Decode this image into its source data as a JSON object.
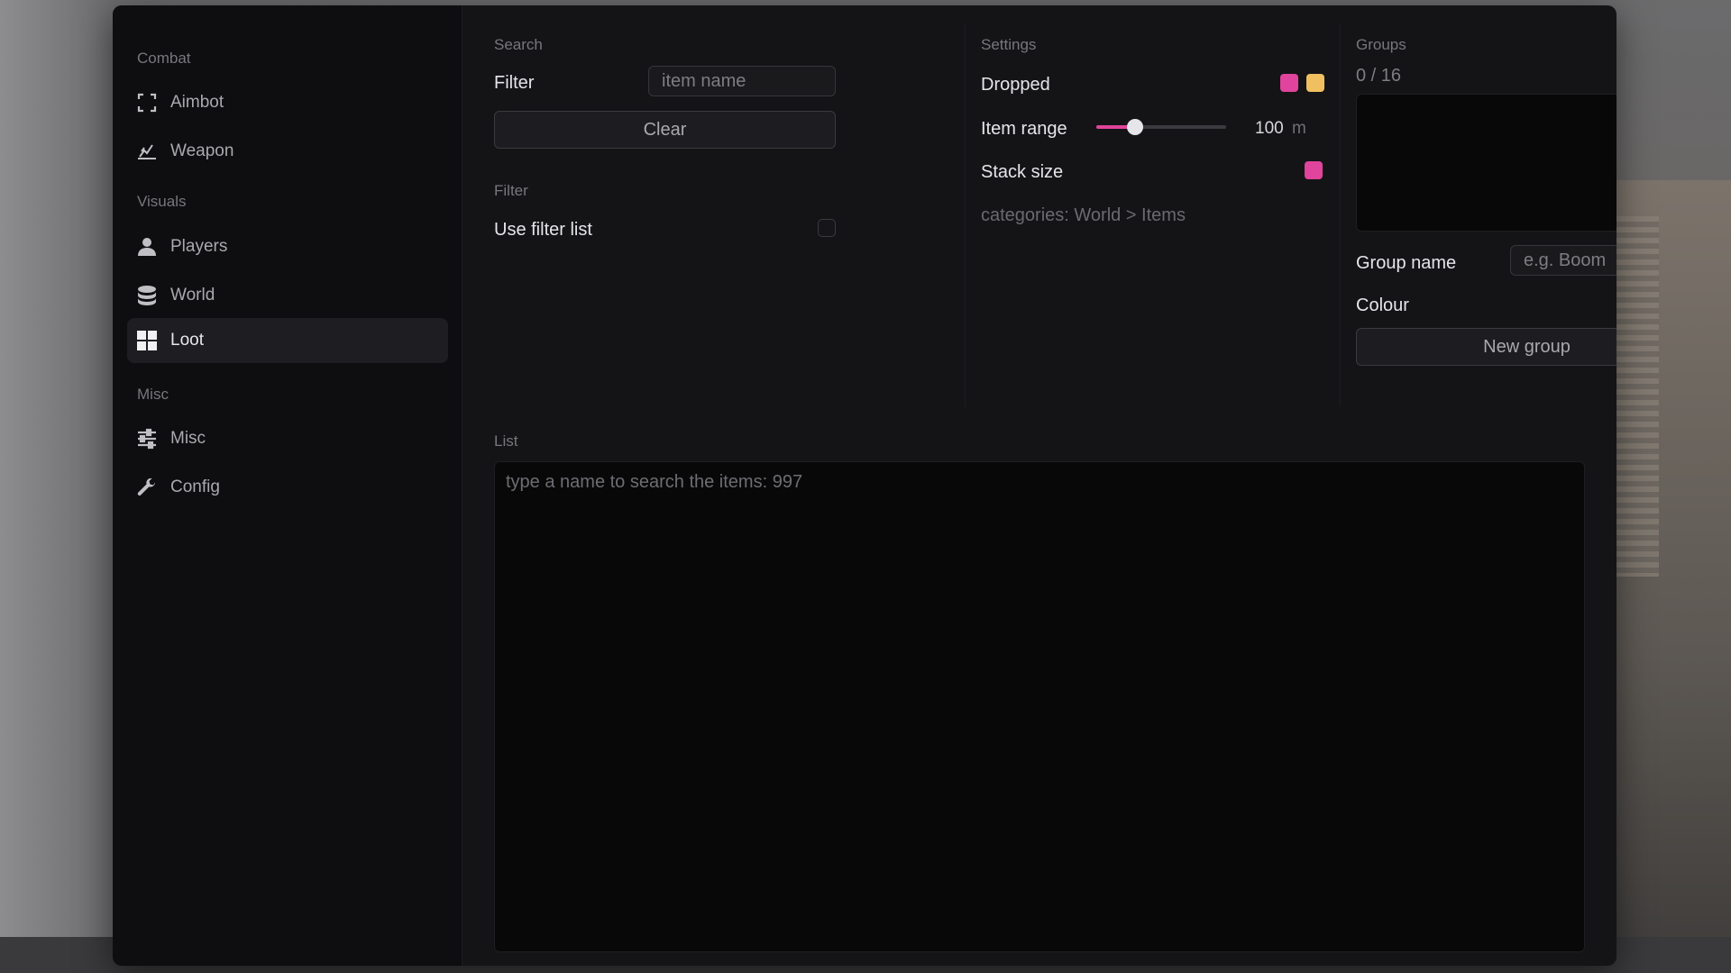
{
  "sidebar": {
    "sections": [
      {
        "title": "Combat",
        "items": [
          {
            "label": "Aimbot",
            "icon": "crosshair-bracket-icon"
          },
          {
            "label": "Weapon",
            "icon": "weapon-icon"
          }
        ]
      },
      {
        "title": "Visuals",
        "items": [
          {
            "label": "Players",
            "icon": "user-icon"
          },
          {
            "label": "World",
            "icon": "database-icon"
          },
          {
            "label": "Loot",
            "icon": "grid-icon",
            "active": true
          }
        ]
      },
      {
        "title": "Misc",
        "items": [
          {
            "label": "Misc",
            "icon": "sliders-icon"
          },
          {
            "label": "Config",
            "icon": "wrench-icon"
          }
        ]
      }
    ]
  },
  "search": {
    "section_title": "Search",
    "filter_label": "Filter",
    "filter_placeholder": "item name",
    "clear_label": "Clear",
    "filter_section_title": "Filter",
    "use_filter_list_label": "Use filter list"
  },
  "settings": {
    "section_title": "Settings",
    "dropped_label": "Dropped",
    "dropped_colors": [
      "#e0449c",
      "#f0c060"
    ],
    "item_range_label": "Item range",
    "item_range_value": "100",
    "item_range_unit": "m",
    "item_range_fraction": 0.3,
    "stack_size_label": "Stack size",
    "stack_size_color": "#e0449c",
    "categories_text": "categories: World > Items"
  },
  "groups": {
    "section_title": "Groups",
    "count": "0 / 16",
    "group_name_label": "Group name",
    "group_name_placeholder": "e.g. Boom",
    "colour_label": "Colour",
    "colour_value": "#e8504a",
    "new_group_label": "New group"
  },
  "list": {
    "section_title": "List",
    "placeholder": "type a name to search the items: 997"
  }
}
